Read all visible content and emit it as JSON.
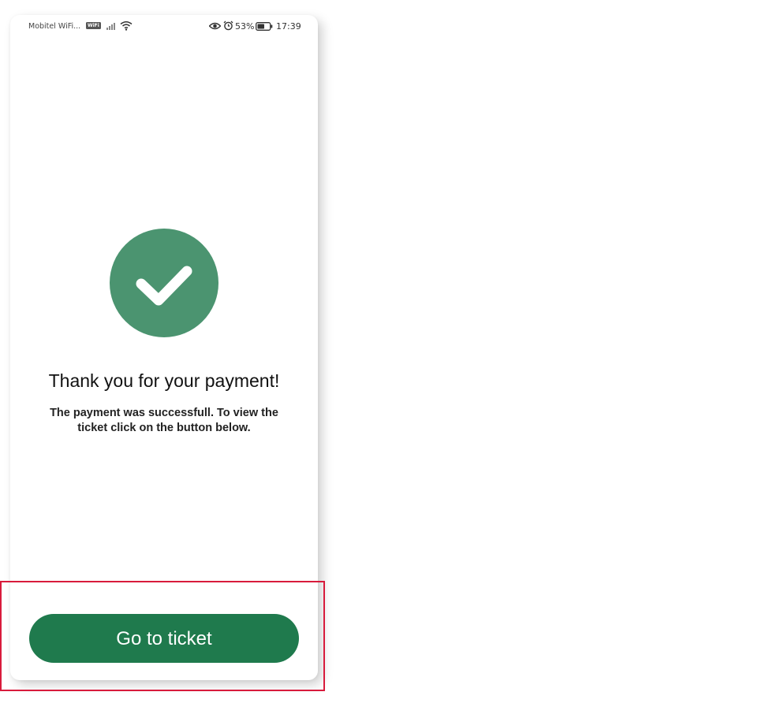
{
  "status_bar": {
    "carrier": "Mobitel WiFi...",
    "wifi_badge": "WiFi",
    "battery_percent": "53%",
    "time": "17:39",
    "icons": [
      "signal-icon",
      "wifi-icon",
      "eye-icon",
      "alarm-icon",
      "battery-icon"
    ]
  },
  "success": {
    "icon": "checkmark-icon",
    "title": "Thank you for your payment!",
    "message": "The payment was successfull. To view the ticket click on the button below."
  },
  "actions": {
    "go_to_ticket_label": "Go to ticket"
  },
  "colors": {
    "check_circle": "#4b9470",
    "primary_button": "#1f7a4d",
    "highlight_border": "#d81b3c"
  }
}
